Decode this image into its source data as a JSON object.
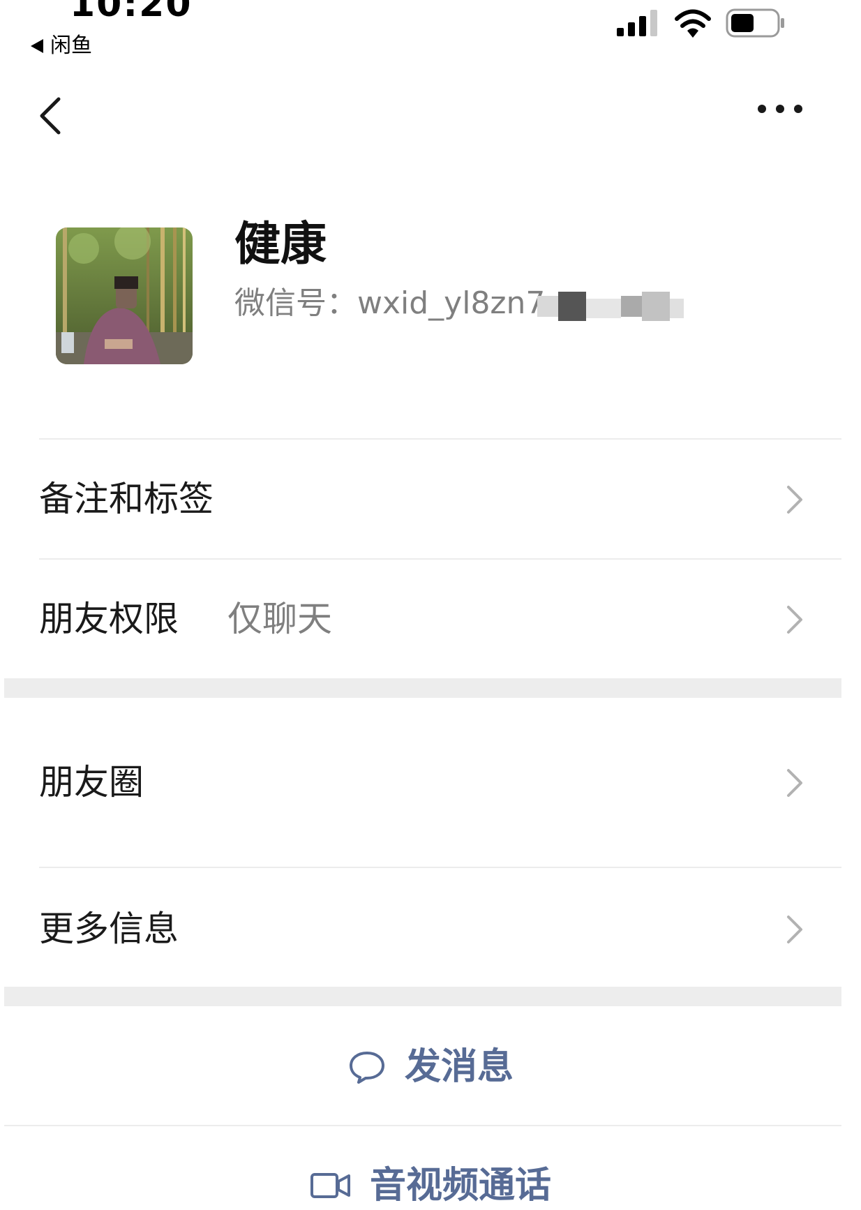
{
  "status_bar": {
    "time": "10:20",
    "back_app": "闲鱼",
    "signal_icon": "cellular-signal-icon",
    "wifi_icon": "wifi-icon",
    "battery_icon": "battery-icon"
  },
  "nav": {
    "back_icon": "chevron-left-icon",
    "more_icon": "more-dots-icon"
  },
  "profile": {
    "name": "健康",
    "wechat_id": "微信号：wxid_yl8zn7"
  },
  "rows": [
    {
      "label": "备注和标签",
      "value": ""
    },
    {
      "label": "朋友权限",
      "value": "仅聊天"
    },
    {
      "label": "朋友圈",
      "value": ""
    },
    {
      "label": "更多信息",
      "value": ""
    }
  ],
  "actions": {
    "message": "发消息",
    "call": "音视频通话"
  },
  "colors": {
    "link": "#576b95",
    "section_gap": "#ededed"
  }
}
